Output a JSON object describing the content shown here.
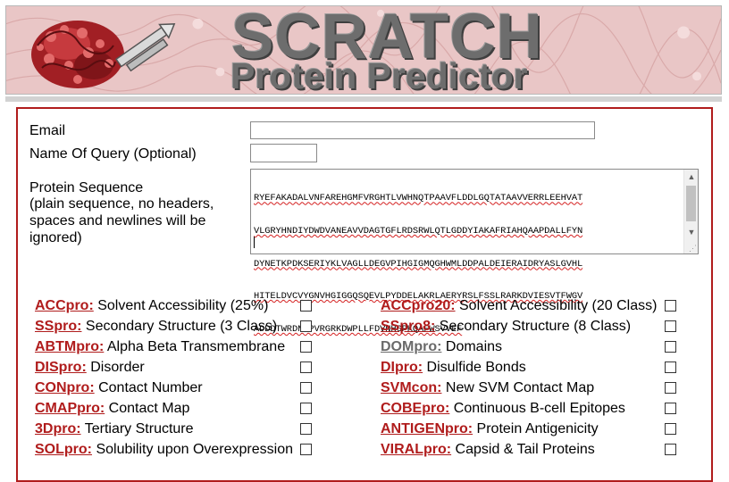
{
  "banner": {
    "title": "SCRATCH",
    "subtitle": "Protein Predictor"
  },
  "form": {
    "email_label": "Email",
    "email_value": "",
    "name_label": "Name Of Query (Optional)",
    "name_value": "",
    "sequence_label": "Protein Sequence",
    "sequence_hint": "(plain sequence, no headers, spaces and newlines will be ignored)",
    "sequence_lines": [
      "RYEFAKADALVNFAREHGMFVRGHTLVWHNQTPAAVFLDDLGQTATAAVVERRLEEHVAT",
      "VLGRYHNDIYDWDVANEAVVDAGTGFLRDSRWLQTLGDDYIAKAFRIAHQAAPDALLFYN",
      "DYNETKPDKSERIYKLVAGLLDEGVPIHGIGMQGHWMLDDPALDEIERAIDRYASLGVHL",
      "HITELDVCVYGNVHGIGGQSQEVLPYDDELAKRLAERYRSLFSSLRARKDVIESVTFWGV",
      "ADDDTWRDNFPVRGRKDWPLLFDVNHGPKQAFWSVVEF"
    ]
  },
  "predictors": [
    {
      "name": "ACCpro:",
      "desc": "Solvent Accessibility (25%)",
      "checked": false,
      "gray": false
    },
    {
      "name": "ACCpro20:",
      "desc": "Solvent Accessibility (20 Class)",
      "checked": false,
      "gray": false
    },
    {
      "name": "SSpro:",
      "desc": "Secondary Structure (3 Class)",
      "checked": false,
      "gray": false
    },
    {
      "name": "SSpro8:",
      "desc": "Secondary Structure (8 Class)",
      "checked": false,
      "gray": false
    },
    {
      "name": "ABTMpro:",
      "desc": "Alpha Beta Transmembrane",
      "checked": false,
      "gray": false
    },
    {
      "name": "DOMpro:",
      "desc": "Domains",
      "checked": false,
      "gray": true
    },
    {
      "name": "DISpro:",
      "desc": "Disorder",
      "checked": false,
      "gray": false
    },
    {
      "name": "DIpro:",
      "desc": "Disulfide Bonds",
      "checked": false,
      "gray": false
    },
    {
      "name": "CONpro:",
      "desc": "Contact Number",
      "checked": false,
      "gray": false
    },
    {
      "name": "SVMcon:",
      "desc": "New SVM Contact Map",
      "checked": false,
      "gray": false
    },
    {
      "name": "CMAPpro:",
      "desc": "Contact Map",
      "checked": false,
      "gray": false
    },
    {
      "name": "COBEpro:",
      "desc": "Continuous B-cell Epitopes",
      "checked": false,
      "gray": false
    },
    {
      "name": "3Dpro:",
      "desc": "Tertiary Structure",
      "checked": false,
      "gray": false
    },
    {
      "name": "ANTIGENpro:",
      "desc": "Protein Antigenicity",
      "checked": false,
      "gray": false
    },
    {
      "name": "SOLpro:",
      "desc": "Solubility upon Overexpression",
      "checked": false,
      "gray": false
    },
    {
      "name": "VIRALpro:",
      "desc": "Capsid & Tail Proteins",
      "checked": false,
      "gray": false
    }
  ],
  "colors": {
    "link": "#b01c1c",
    "link_disabled": "#6a6a6a",
    "panel_border": "#b01c1c",
    "banner_bg": "#e9c6c6"
  }
}
